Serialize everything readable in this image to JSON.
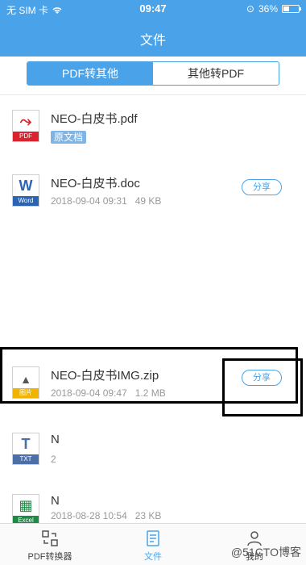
{
  "status_bar": {
    "carrier": "无 SIM 卡",
    "time": "09:47",
    "battery": "36%",
    "battery_level": 0.36
  },
  "nav": {
    "title": "文件"
  },
  "segmented": {
    "tabs": [
      {
        "label": "PDF转其他",
        "active": true
      },
      {
        "label": "其他转PDF",
        "active": false
      }
    ]
  },
  "files": [
    {
      "name": "NEO-白皮书.pdf",
      "icon_type": "pdf-icon",
      "icon_tag": "PDF",
      "icon_glyph": "⤳",
      "tag_color": "#d9232e",
      "badge": "原文档"
    },
    {
      "name": "NEO-白皮书.doc",
      "icon_type": "word-icon",
      "icon_tag": "Word",
      "icon_glyph": "W",
      "tag_color": "#2b64b3",
      "meta": "2018-09-04 09:31   49 KB",
      "share": "分享"
    },
    {
      "name": "NEO-白皮书IMG.zip",
      "icon_type": "image-icon",
      "icon_tag": "图片",
      "icon_glyph": "▲",
      "tag_color": "#f0b400",
      "meta": "2018-09-04 09:47   1.2 MB",
      "share": "分享"
    },
    {
      "name": "N",
      "icon_type": "txt-icon",
      "icon_tag": "TXT",
      "icon_glyph": "T",
      "tag_color": "#4d6fa8",
      "meta": "2",
      "share": ""
    },
    {
      "name": "N",
      "icon_type": "excel-icon",
      "icon_tag": "Excel",
      "icon_glyph": "▦",
      "tag_color": "#1f8a45",
      "meta": "2018-08-28 10:54   23 KB",
      "share": ""
    }
  ],
  "tabbar": {
    "items": [
      {
        "label": "PDF转换器",
        "icon": "converter-icon",
        "active": false
      },
      {
        "label": "文件",
        "icon": "file-icon",
        "active": true
      },
      {
        "label": "我的",
        "icon": "profile-icon",
        "active": false
      }
    ]
  },
  "watermark": "@51CTO博客"
}
